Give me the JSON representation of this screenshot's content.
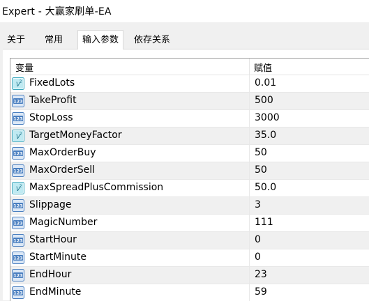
{
  "window": {
    "title": "Expert - 大赢家刷单-EA"
  },
  "tabs": [
    {
      "label": "关于"
    },
    {
      "label": "常用"
    },
    {
      "label": "输入参数"
    },
    {
      "label": "依存关系"
    }
  ],
  "table": {
    "headers": {
      "variable": "变量",
      "value": "赋值"
    },
    "rows": [
      {
        "icon": "double-value-icon",
        "name": "FixedLots",
        "value": "0.01"
      },
      {
        "icon": "integer-value-icon",
        "name": "TakeProfit",
        "value": "500"
      },
      {
        "icon": "integer-value-icon",
        "name": "StopLoss",
        "value": "3000"
      },
      {
        "icon": "double-value-icon",
        "name": "TargetMoneyFactor",
        "value": "35.0"
      },
      {
        "icon": "integer-value-icon",
        "name": "MaxOrderBuy",
        "value": "50"
      },
      {
        "icon": "integer-value-icon",
        "name": "MaxOrderSell",
        "value": "50"
      },
      {
        "icon": "double-value-icon",
        "name": "MaxSpreadPlusCommission",
        "value": "50.0"
      },
      {
        "icon": "integer-value-icon",
        "name": "Slippage",
        "value": "3"
      },
      {
        "icon": "integer-value-icon",
        "name": "MagicNumber",
        "value": "111"
      },
      {
        "icon": "integer-value-icon",
        "name": "StartHour",
        "value": "0"
      },
      {
        "icon": "integer-value-icon",
        "name": "StartMinute",
        "value": "0"
      },
      {
        "icon": "integer-value-icon",
        "name": "EndHour",
        "value": "23"
      },
      {
        "icon": "integer-value-icon",
        "name": "EndMinute",
        "value": "59"
      }
    ]
  }
}
